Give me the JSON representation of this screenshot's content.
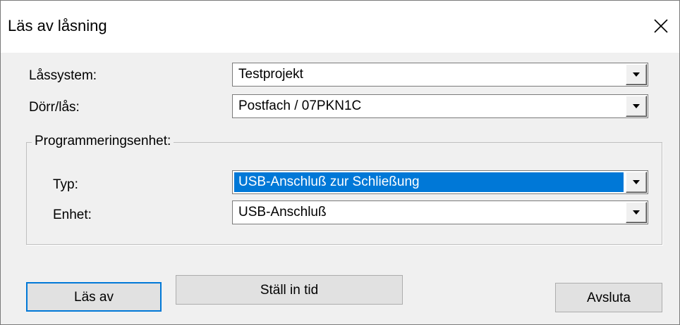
{
  "window": {
    "title": "Läs av låsning",
    "close_icon": "close-icon"
  },
  "fields": {
    "lassystem": {
      "label": "Låssystem:",
      "value": "Testprojekt"
    },
    "dorr_las": {
      "label": "Dörr/lås:",
      "value": "Postfach / 07PKN1C"
    }
  },
  "programming_unit": {
    "legend": "Programmeringsenhet:",
    "typ": {
      "label": "Typ:",
      "value": "USB-Anschluß zur Schließung"
    },
    "enhet": {
      "label": "Enhet:",
      "value": "USB-Anschluß"
    }
  },
  "buttons": {
    "read": "Läs av",
    "set_time": "Ställ in tid",
    "exit": "Avsluta"
  },
  "colors": {
    "selection": "#0078d7",
    "dialog_background": "#f0f0f0"
  }
}
